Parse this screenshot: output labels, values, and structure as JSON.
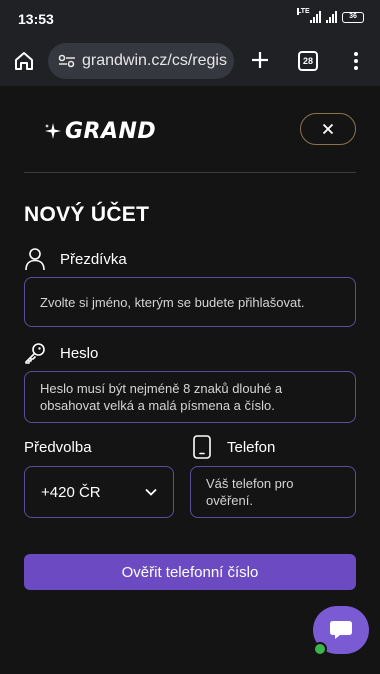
{
  "status_bar": {
    "time": "13:53",
    "network": "LTE",
    "battery": "36"
  },
  "browser": {
    "url": "grandwin.cz/cs/regis",
    "tab_count": "28"
  },
  "header": {
    "logo_text": "GRAND"
  },
  "form": {
    "title": "NOVÝ ÚČET",
    "nickname": {
      "label": "Přezdívka",
      "placeholder": "Zvolte si jméno, kterým se budete přihlašovat."
    },
    "password": {
      "label": "Heslo",
      "placeholder": "Heslo musí být nejméně 8 znaků dlouhé a obsahovat velká a malá písmena a číslo."
    },
    "prefix": {
      "label": "Předvolba",
      "value": "+420 ČR"
    },
    "phone": {
      "label": "Telefon",
      "placeholder": "Váš telefon pro ověření."
    },
    "verify_button": "Ověřit telefonní číslo"
  },
  "colors": {
    "accent": "#6c4bc2",
    "input_border": "#5a4d9c",
    "close_border": "#8a7349",
    "chat": "#7b5bd3",
    "online": "#3bb54a"
  },
  "icons": [
    "home-icon",
    "site-settings-icon",
    "plus-icon",
    "tabs-icon",
    "more-icon",
    "sparkle-icon",
    "close-icon",
    "user-icon",
    "key-icon",
    "phone-icon",
    "chevron-down-icon",
    "chat-icon"
  ]
}
